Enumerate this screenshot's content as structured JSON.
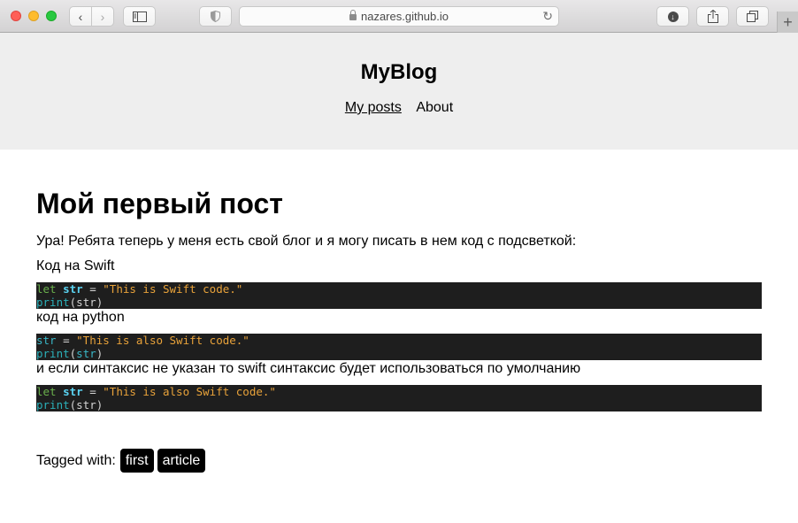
{
  "browser": {
    "url": "nazares.github.io",
    "buttons": {
      "back": "‹",
      "forward": "›",
      "new_tab": "+"
    },
    "icons": [
      "back-icon",
      "forward-icon",
      "sidebar-icon",
      "shield-icon",
      "lock-icon",
      "reload-icon",
      "download-icon",
      "share-icon",
      "tabs-overview-icon",
      "new-tab-icon"
    ]
  },
  "site": {
    "title": "MyBlog",
    "nav": [
      {
        "label": "My posts",
        "active": true
      },
      {
        "label": "About",
        "active": false
      }
    ]
  },
  "post": {
    "title": "Мой первый пост",
    "intro": "Ура! Ребята теперь у меня есть свой блог и я могу писать в нем код с подсветкой:",
    "swift_label": "Код на Swift",
    "code_blocks": [
      {
        "line1": {
          "keyword": "let",
          "var": "str",
          "op": " = ",
          "string": "\"This is Swift code.\""
        },
        "line2": {
          "fn": "print",
          "arg": "(str)"
        }
      },
      {
        "line1": {
          "var": "str",
          "op": " = ",
          "string": "\"This is also Swift code.\""
        },
        "line2": {
          "fn": "print",
          "arg_open": "(",
          "arg": "str",
          "arg_close": ")"
        }
      },
      {
        "line1": {
          "keyword": "let",
          "var": "str",
          "op": " = ",
          "string": "\"This is also Swift code.\""
        },
        "line2": {
          "fn": "print",
          "arg": "(str)"
        }
      }
    ],
    "python_label": "код на python",
    "default_note": "и если синтаксис не указан то swift синтаксис будет использоваться по умолчанию",
    "tags_label": "Tagged with:",
    "tags": [
      "first",
      "article"
    ]
  },
  "colors": {
    "header_bg": "#eeeeee",
    "code_bg": "#1e1e1e",
    "keyword": "#6ab04c",
    "variable": "#5ad2f0",
    "string": "#e8a23a",
    "function": "#2bb0b9",
    "tag_bg": "#000000"
  }
}
